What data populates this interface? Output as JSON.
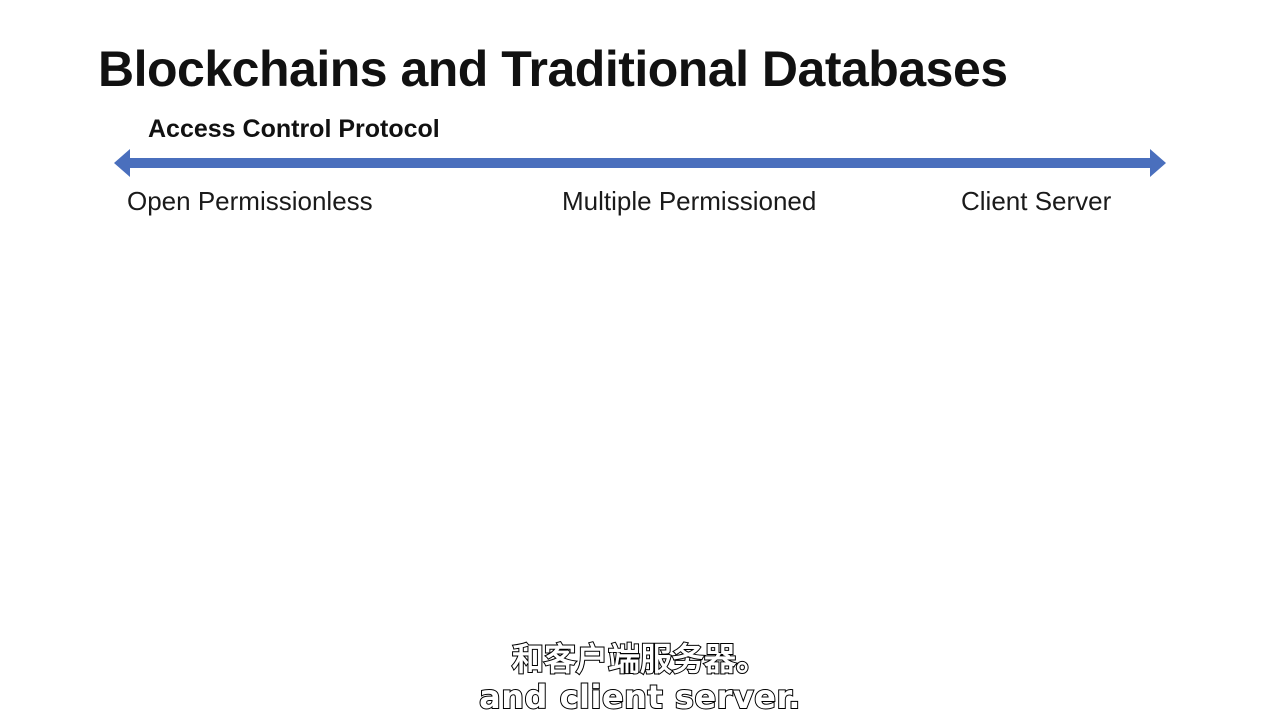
{
  "slide": {
    "title": "Blockchains and Traditional Databases",
    "subtitle": "Access Control Protocol",
    "spectrum": {
      "color": "#4a6fbd",
      "labels": {
        "left": "Open Permissionless",
        "middle": "Multiple Permissioned",
        "right": "Client Server"
      }
    }
  },
  "captions": {
    "zh": "和客户端服务器。",
    "en": "and client server."
  }
}
